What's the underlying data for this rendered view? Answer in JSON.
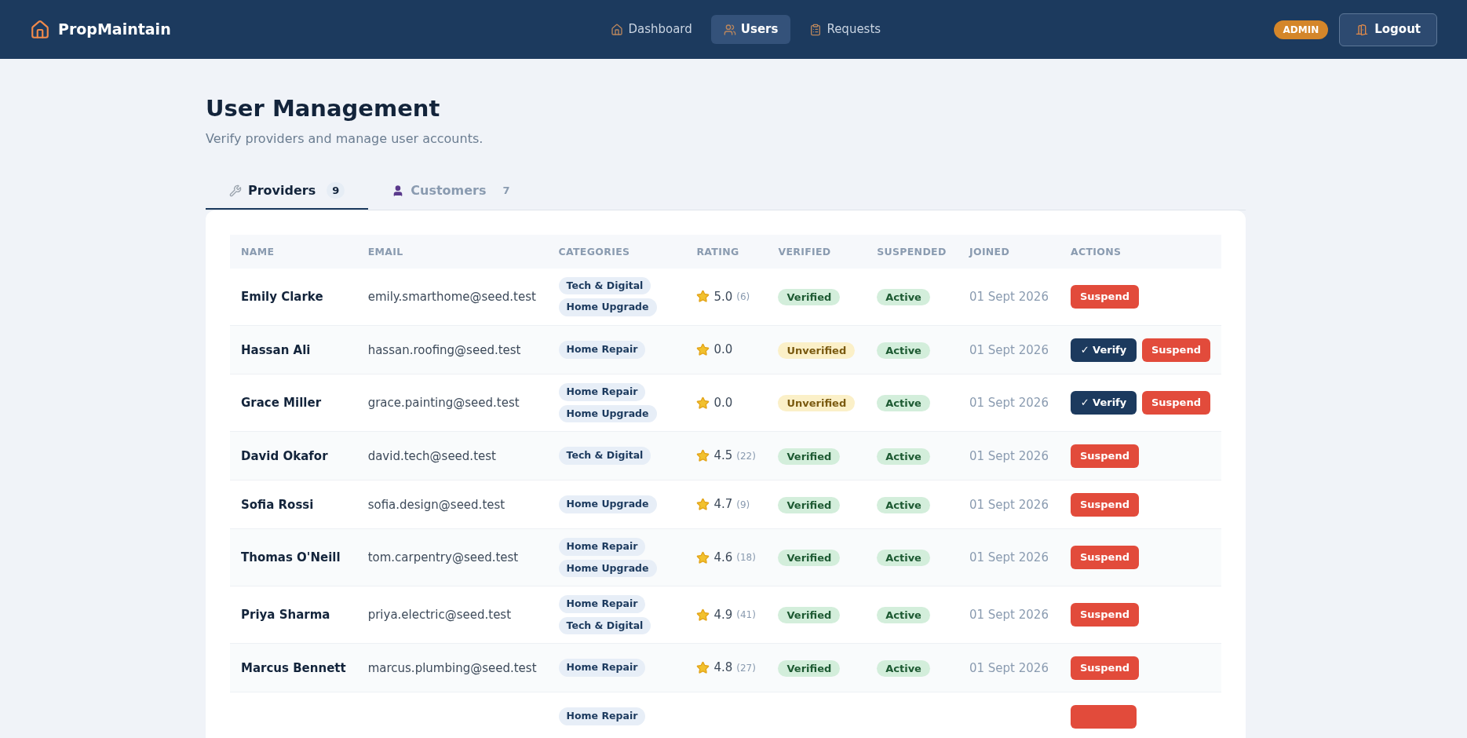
{
  "brand": {
    "name": "PropMaintain"
  },
  "nav": [
    {
      "label": "Dashboard",
      "selected": false
    },
    {
      "label": "Users",
      "selected": true
    },
    {
      "label": "Requests",
      "selected": false
    }
  ],
  "role_badge": "ADMIN",
  "logout": "Logout",
  "page": {
    "title": "User Management",
    "subtitle": "Verify providers and manage user accounts."
  },
  "tabs": [
    {
      "label": "Providers",
      "count": "9",
      "selected": true
    },
    {
      "label": "Customers",
      "count": "7",
      "selected": false
    }
  ],
  "table": {
    "columns": [
      "NAME",
      "EMAIL",
      "CATEGORIES",
      "RATING",
      "VERIFIED",
      "SUSPENDED",
      "JOINED",
      "ACTIONS"
    ],
    "rows": [
      {
        "name": "Emily Clarke",
        "email": "emily.smarthome@seed.test",
        "categories": [
          "Tech & Digital",
          "Home Upgrade"
        ],
        "rating": "5.0",
        "reviews": "(6)",
        "verified": true,
        "verified_label": "Verified",
        "status": "Active",
        "joined": "01 Sept 2026",
        "actions": [
          {
            "kind": "suspend",
            "label": "Suspend"
          }
        ]
      },
      {
        "name": "Hassan Ali",
        "email": "hassan.roofing@seed.test",
        "categories": [
          "Home Repair"
        ],
        "rating": "0.0",
        "verified": false,
        "verified_label": "Unverified",
        "status": "Active",
        "joined": "01 Sept 2026",
        "actions": [
          {
            "kind": "verify",
            "label": "✓ Verify"
          },
          {
            "kind": "suspend",
            "label": "Suspend"
          }
        ]
      },
      {
        "name": "Grace Miller",
        "email": "grace.painting@seed.test",
        "categories": [
          "Home Repair",
          "Home Upgrade"
        ],
        "rating": "0.0",
        "verified": false,
        "verified_label": "Unverified",
        "status": "Active",
        "joined": "01 Sept 2026",
        "actions": [
          {
            "kind": "verify",
            "label": "✓ Verify"
          },
          {
            "kind": "suspend",
            "label": "Suspend"
          }
        ]
      },
      {
        "name": "David Okafor",
        "email": "david.tech@seed.test",
        "categories": [
          "Tech & Digital"
        ],
        "rating": "4.5",
        "reviews": "(22)",
        "verified": true,
        "verified_label": "Verified",
        "status": "Active",
        "joined": "01 Sept 2026",
        "actions": [
          {
            "kind": "suspend",
            "label": "Suspend"
          }
        ]
      },
      {
        "name": "Sofia Rossi",
        "email": "sofia.design@seed.test",
        "categories": [
          "Home Upgrade"
        ],
        "rating": "4.7",
        "reviews": "(9)",
        "verified": true,
        "verified_label": "Verified",
        "status": "Active",
        "joined": "01 Sept 2026",
        "actions": [
          {
            "kind": "suspend",
            "label": "Suspend"
          }
        ]
      },
      {
        "name": "Thomas O'Neill",
        "email": "tom.carpentry@seed.test",
        "categories": [
          "Home Repair",
          "Home Upgrade"
        ],
        "rating": "4.6",
        "reviews": "(18)",
        "verified": true,
        "verified_label": "Verified",
        "status": "Active",
        "joined": "01 Sept 2026",
        "actions": [
          {
            "kind": "suspend",
            "label": "Suspend"
          }
        ]
      },
      {
        "name": "Priya Sharma",
        "email": "priya.electric@seed.test",
        "categories": [
          "Home Repair",
          "Tech & Digital"
        ],
        "rating": "4.9",
        "reviews": "(41)",
        "verified": true,
        "verified_label": "Verified",
        "status": "Active",
        "joined": "01 Sept 2026",
        "actions": [
          {
            "kind": "suspend",
            "label": "Suspend"
          }
        ]
      },
      {
        "name": "Marcus Bennett",
        "email": "marcus.plumbing@seed.test",
        "categories": [
          "Home Repair"
        ],
        "rating": "4.8",
        "reviews": "(27)",
        "verified": true,
        "verified_label": "Verified",
        "status": "Active",
        "joined": "01 Sept 2026",
        "actions": [
          {
            "kind": "suspend",
            "label": "Suspend"
          }
        ]
      },
      {
        "categories": [
          "Home Repair"
        ],
        "actions": [
          {
            "kind": "suspend"
          }
        ]
      }
    ]
  }
}
